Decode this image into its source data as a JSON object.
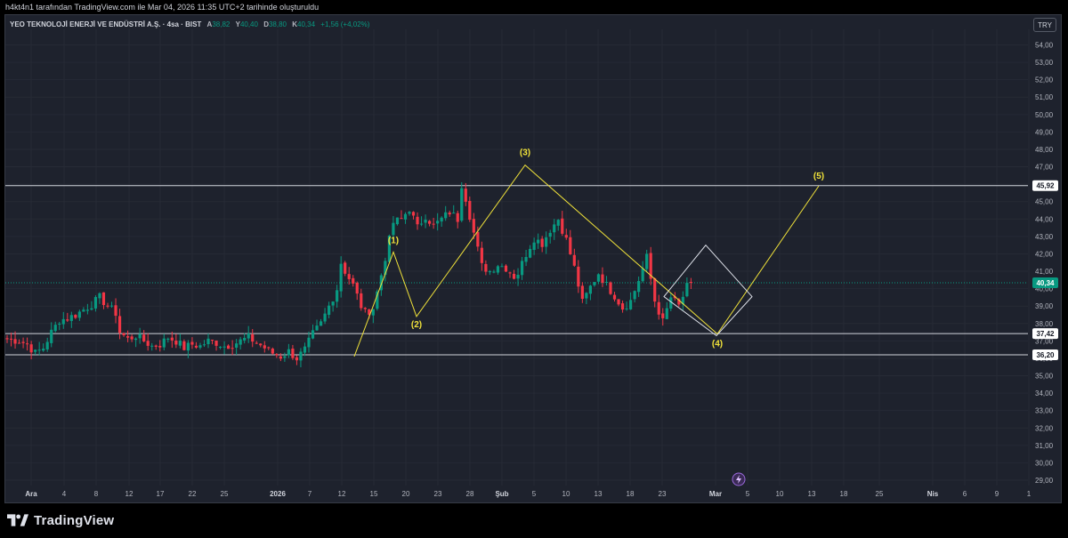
{
  "attribution": "h4kt4n1 tarafından TradingView.com ile Mar 04, 2026 11:35 UTC+2 tarihinde oluşturuldu",
  "symbol": {
    "name": "YEO TEKNOLOJİ ENERJİ VE ENDÜSTRİ A.Ş. · 4sa · BIST",
    "open_label": "A",
    "open": "38,82",
    "high_label": "Y",
    "high": "40,40",
    "low_label": "D",
    "low": "38,80",
    "close_label": "K",
    "close": "40,34",
    "change": "+1,56 (+4,02%)"
  },
  "currency": "TRY",
  "brand": "TradingView",
  "colors": {
    "up": "#089981",
    "down": "#f23645",
    "wave": "#f0e23a",
    "background": "#1e222d"
  },
  "chart_data": {
    "type": "candlestick",
    "y_axis": {
      "min": 29,
      "max": 54,
      "step": 1,
      "side": "right",
      "labels": [
        "54,00",
        "53,00",
        "52,00",
        "51,00",
        "50,00",
        "49,00",
        "48,00",
        "47,00",
        "46,00",
        "45,00",
        "44,00",
        "43,00",
        "42,00",
        "41,00",
        "40,00",
        "39,00",
        "38,00",
        "37,00",
        "36,00",
        "35,00",
        "34,00",
        "33,00",
        "32,00",
        "31,00",
        "30,00",
        "29,00"
      ]
    },
    "x_axis": {
      "labels": [
        "Ara",
        "4",
        "8",
        "12",
        "17",
        "22",
        "25",
        "2026",
        "7",
        "12",
        "15",
        "20",
        "23",
        "28",
        "Şub",
        "5",
        "10",
        "13",
        "18",
        "23",
        "Mar",
        "5",
        "10",
        "13",
        "18",
        "25",
        "Nis",
        "6",
        "9",
        "1"
      ],
      "bold": [
        "Ara",
        "2026",
        "Şub",
        "Mar",
        "Nis"
      ]
    },
    "horizontal_levels": [
      45.92,
      37.42,
      36.2
    ],
    "last_price": 40.34,
    "price_tags": [
      "45,92",
      "40,34",
      "37,42",
      "36,20"
    ],
    "elliott_waves": [
      {
        "label": "(1)",
        "value": 42.1
      },
      {
        "label": "(2)",
        "value": 38.4
      },
      {
        "label": "(3)",
        "value": 47.1
      },
      {
        "label": "(4)",
        "value": 37.4
      },
      {
        "label": "(5)",
        "value": 45.9
      }
    ],
    "diamond_pattern": {
      "top": 42.5,
      "bottom": 37.3
    },
    "close_path": [
      [
        0,
        37.1
      ],
      [
        3,
        37.0
      ],
      [
        5,
        36.8
      ],
      [
        7,
        36.3
      ],
      [
        9,
        36.6
      ],
      [
        11,
        37.5
      ],
      [
        13,
        38.2
      ],
      [
        15,
        38.3
      ],
      [
        17,
        38.5
      ],
      [
        19,
        38.8
      ],
      [
        21,
        39.1
      ],
      [
        23,
        39.5
      ],
      [
        25,
        39.0
      ],
      [
        27,
        38.6
      ],
      [
        28,
        37.5
      ],
      [
        30,
        37.1
      ],
      [
        32,
        37.3
      ],
      [
        34,
        37.0
      ],
      [
        36,
        36.7
      ],
      [
        38,
        36.8
      ],
      [
        40,
        37.2
      ],
      [
        42,
        37.0
      ],
      [
        44,
        36.6
      ],
      [
        46,
        36.8
      ],
      [
        48,
        36.7
      ],
      [
        50,
        37.0
      ],
      [
        52,
        36.9
      ],
      [
        54,
        36.7
      ],
      [
        56,
        36.8
      ],
      [
        58,
        37.0
      ],
      [
        60,
        37.2
      ],
      [
        62,
        36.9
      ],
      [
        64,
        36.6
      ],
      [
        66,
        36.3
      ],
      [
        68,
        36.1
      ],
      [
        70,
        36.4
      ],
      [
        72,
        36.0
      ],
      [
        74,
        36.5
      ],
      [
        76,
        37.4
      ],
      [
        78,
        38.0
      ],
      [
        80,
        39.0
      ],
      [
        82,
        40.0
      ],
      [
        83,
        41.5
      ],
      [
        84,
        41.0
      ],
      [
        86,
        40.2
      ],
      [
        88,
        39.0
      ],
      [
        89,
        38.6
      ],
      [
        91,
        38.9
      ],
      [
        92,
        39.8
      ],
      [
        94,
        41.8
      ],
      [
        96,
        43.8
      ],
      [
        98,
        44.0
      ],
      [
        100,
        44.6
      ],
      [
        102,
        43.5
      ],
      [
        104,
        44.2
      ],
      [
        106,
        43.6
      ],
      [
        108,
        44.0
      ],
      [
        110,
        44.4
      ],
      [
        112,
        44.0
      ],
      [
        113,
        46.0
      ],
      [
        114,
        45.2
      ],
      [
        116,
        43.2
      ],
      [
        118,
        41.3
      ],
      [
        120,
        41.0
      ],
      [
        122,
        41.4
      ],
      [
        124,
        41.2
      ],
      [
        126,
        40.7
      ],
      [
        127,
        40.9
      ],
      [
        129,
        42.0
      ],
      [
        131,
        42.9
      ],
      [
        133,
        42.6
      ],
      [
        135,
        43.4
      ],
      [
        137,
        44.0
      ],
      [
        139,
        42.8
      ],
      [
        141,
        41.2
      ],
      [
        143,
        39.2
      ],
      [
        145,
        40.1
      ],
      [
        147,
        40.9
      ],
      [
        149,
        40.2
      ],
      [
        151,
        39.6
      ],
      [
        153,
        38.9
      ],
      [
        155,
        39.3
      ],
      [
        157,
        40.5
      ],
      [
        159,
        41.8
      ],
      [
        161,
        39.3
      ],
      [
        163,
        38.1
      ],
      [
        165,
        39.5
      ],
      [
        167,
        39.0
      ],
      [
        169,
        40.1
      ],
      [
        170,
        40.34
      ]
    ]
  }
}
